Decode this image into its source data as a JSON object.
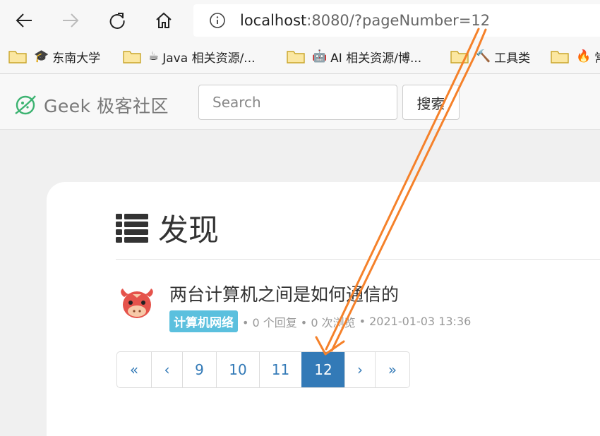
{
  "browser": {
    "url_host": "localhost",
    "url_rest": ":8080/?pageNumber=12"
  },
  "bookmarks": [
    {
      "label": "东南大学",
      "icon": "graduation-cap-icon"
    },
    {
      "label": "Java 相关资源/...",
      "icon": "coffee-icon"
    },
    {
      "label": "AI 相关资源/博...",
      "icon": "robot-icon"
    },
    {
      "label": "工具类",
      "icon": "hammer-icon"
    },
    {
      "label": "常",
      "icon": "fire-icon"
    }
  ],
  "site": {
    "brand": "Geek 极客社区",
    "search_placeholder": "Search",
    "search_button": "搜索"
  },
  "main": {
    "title": "发现",
    "post": {
      "title": "两台计算机之间是如何通信的",
      "tag": "计算机网络",
      "replies": "• 0 个回复",
      "views": "• 0 次浏览",
      "time": "• 2021-01-03 13:36"
    },
    "pagination": [
      "«",
      "‹",
      "9",
      "10",
      "11",
      "12",
      "›",
      "»"
    ],
    "active_page": "12"
  },
  "colors": {
    "accent": "#337ab7",
    "tag": "#5bc0de",
    "annotation_arrow": "#f5812a"
  }
}
